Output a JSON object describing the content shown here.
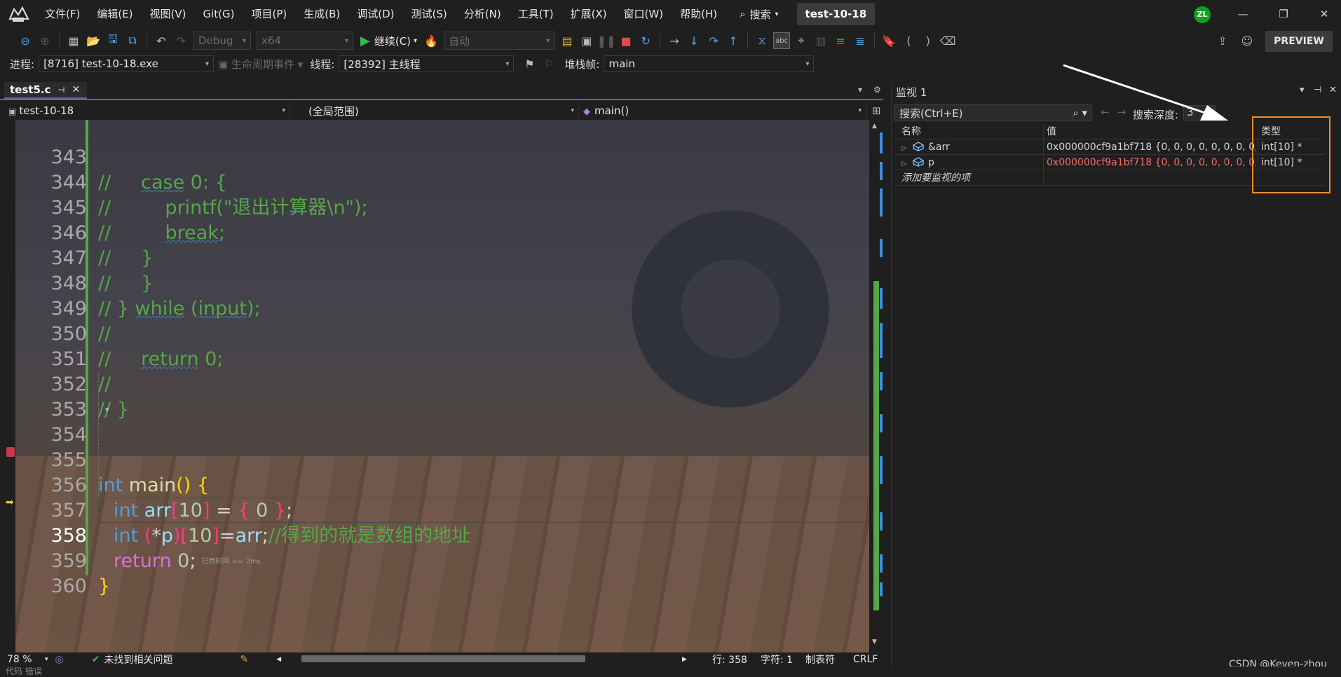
{
  "menubar": {
    "items": [
      "文件(F)",
      "编辑(E)",
      "视图(V)",
      "Git(G)",
      "项目(P)",
      "生成(B)",
      "调试(D)",
      "测试(S)",
      "分析(N)",
      "工具(T)",
      "扩展(X)",
      "窗口(W)",
      "帮助(H)"
    ],
    "search_label": "搜索",
    "solution_title": "test-10-18",
    "avatar_initials": "ZL",
    "accent_avatar": "#11a121"
  },
  "toolbar": {
    "config": "Debug",
    "platform": "x64",
    "continue_label": "继续(C)",
    "auto_combo": "自动",
    "preview_label": "PREVIEW"
  },
  "debugbar": {
    "process_label": "进程:",
    "process_value": "[8716] test-10-18.exe",
    "lifecycle_label": "生命周期事件",
    "thread_label": "线程:",
    "thread_value": "[28392] 主线程",
    "stackframe_label": "堆栈帧:",
    "stackframe_value": "main"
  },
  "editor": {
    "tab_name": "test5.c",
    "nav_project": "test-10-18",
    "nav_scope": "(全局范围)",
    "nav_function": "main()",
    "lines": [
      {
        "n": "343",
        "text": "//     case 0: {"
      },
      {
        "n": "344",
        "text": "//         printf(\"退出计算器\\n\");"
      },
      {
        "n": "345",
        "text": "//         break;"
      },
      {
        "n": "346",
        "text": "//     }"
      },
      {
        "n": "347",
        "text": "//     }"
      },
      {
        "n": "348",
        "text": "// } while (input);"
      },
      {
        "n": "349",
        "text": "//"
      },
      {
        "n": "350",
        "text": "//     return 0;"
      },
      {
        "n": "351",
        "text": "//"
      },
      {
        "n": "352",
        "text": "// }"
      },
      {
        "n": "353",
        "text": ""
      },
      {
        "n": "354",
        "text": "int main() {"
      },
      {
        "n": "355",
        "text": ""
      },
      {
        "n": "356",
        "text": "int arr[10] = { 0 };"
      },
      {
        "n": "357",
        "text": "int (*p)[10]=arr;//得到的就是数组的地址"
      },
      {
        "n": "358",
        "text": "return 0;"
      },
      {
        "n": "359",
        "text": "}"
      },
      {
        "n": "360",
        "text": ""
      }
    ],
    "elapsed_hint": "已用时间 <= 2ms",
    "current_line": "358"
  },
  "editor_status": {
    "zoom": "78 %",
    "issues": "未找到相关问题",
    "line": "行: 358",
    "col": "字符: 1",
    "tabs": "制表符",
    "eol": "CRLF"
  },
  "watch": {
    "title": "监视 1",
    "search_placeholder": "搜索(Ctrl+E)",
    "depth_label": "搜索深度:",
    "depth_value": "3",
    "col_name": "名称",
    "col_value": "值",
    "col_type": "类型",
    "rows": [
      {
        "name": "&arr",
        "value": "0x000000cf9a1bf718 {0, 0, 0, 0, 0, 0, 0, 0, 0, 0}",
        "type": "int[10] *"
      },
      {
        "name": "p",
        "value": "0x000000cf9a1bf718 {0, 0, 0, 0, 0, 0, 0, 0, 0, 0}",
        "type": "int[10] *"
      }
    ],
    "add_watch_label": "添加要监视的项",
    "highlight_color": "#f08c2c"
  },
  "watermark": "CSDN @Keven-zhou",
  "bottom_text": "代码  错误"
}
